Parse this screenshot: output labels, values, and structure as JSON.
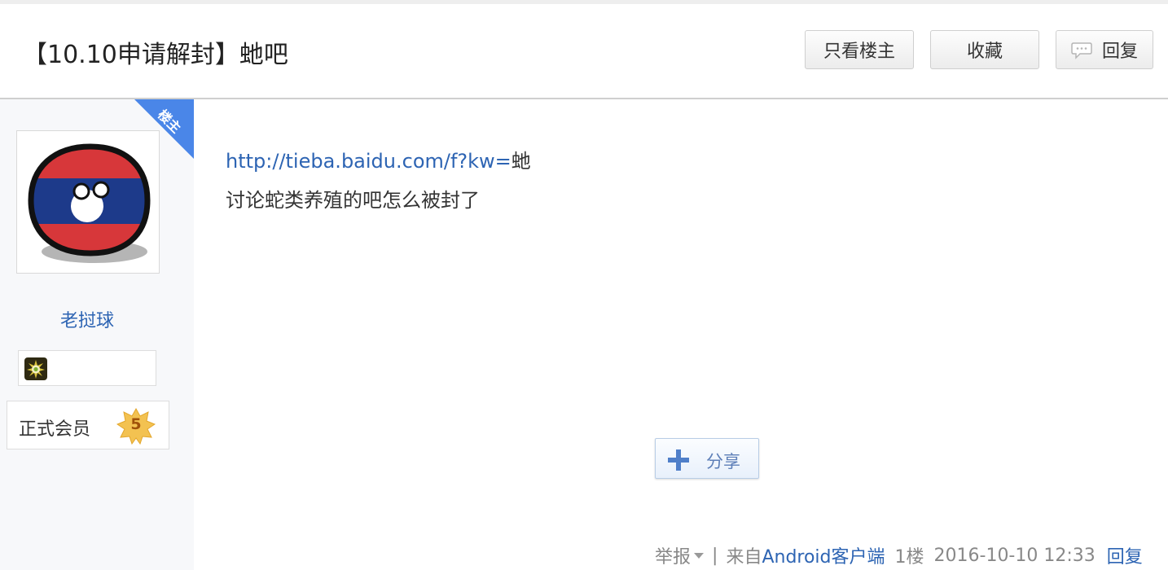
{
  "thread": {
    "title": "【10.10申请解封】虵吧"
  },
  "toolbar": {
    "only_op_label": "只看楼主",
    "favorite_label": "收藏",
    "reply_label": "回复"
  },
  "author": {
    "corner_badge": "楼主",
    "username": "老挝球",
    "member_label": "正式会员",
    "level": "5",
    "avatar_icon": "laos-countryball-icon"
  },
  "post": {
    "link_prefix": "http://tieba.baidu.com/f?kw=",
    "link_tail": "虵",
    "text": "讨论蛇类养殖的吧怎么被封了"
  },
  "share": {
    "label": "分享"
  },
  "footer": {
    "report_label": "举报",
    "separator": "|",
    "source_prefix": "来自",
    "source_client": "Android客户端",
    "floor": "1楼",
    "timestamp": "2016-10-10 12:33",
    "reply_label": "回复"
  },
  "colors": {
    "link": "#2d64b3",
    "badge_blue": "#4a86e8",
    "sidebar_bg": "#f7f8fa"
  }
}
